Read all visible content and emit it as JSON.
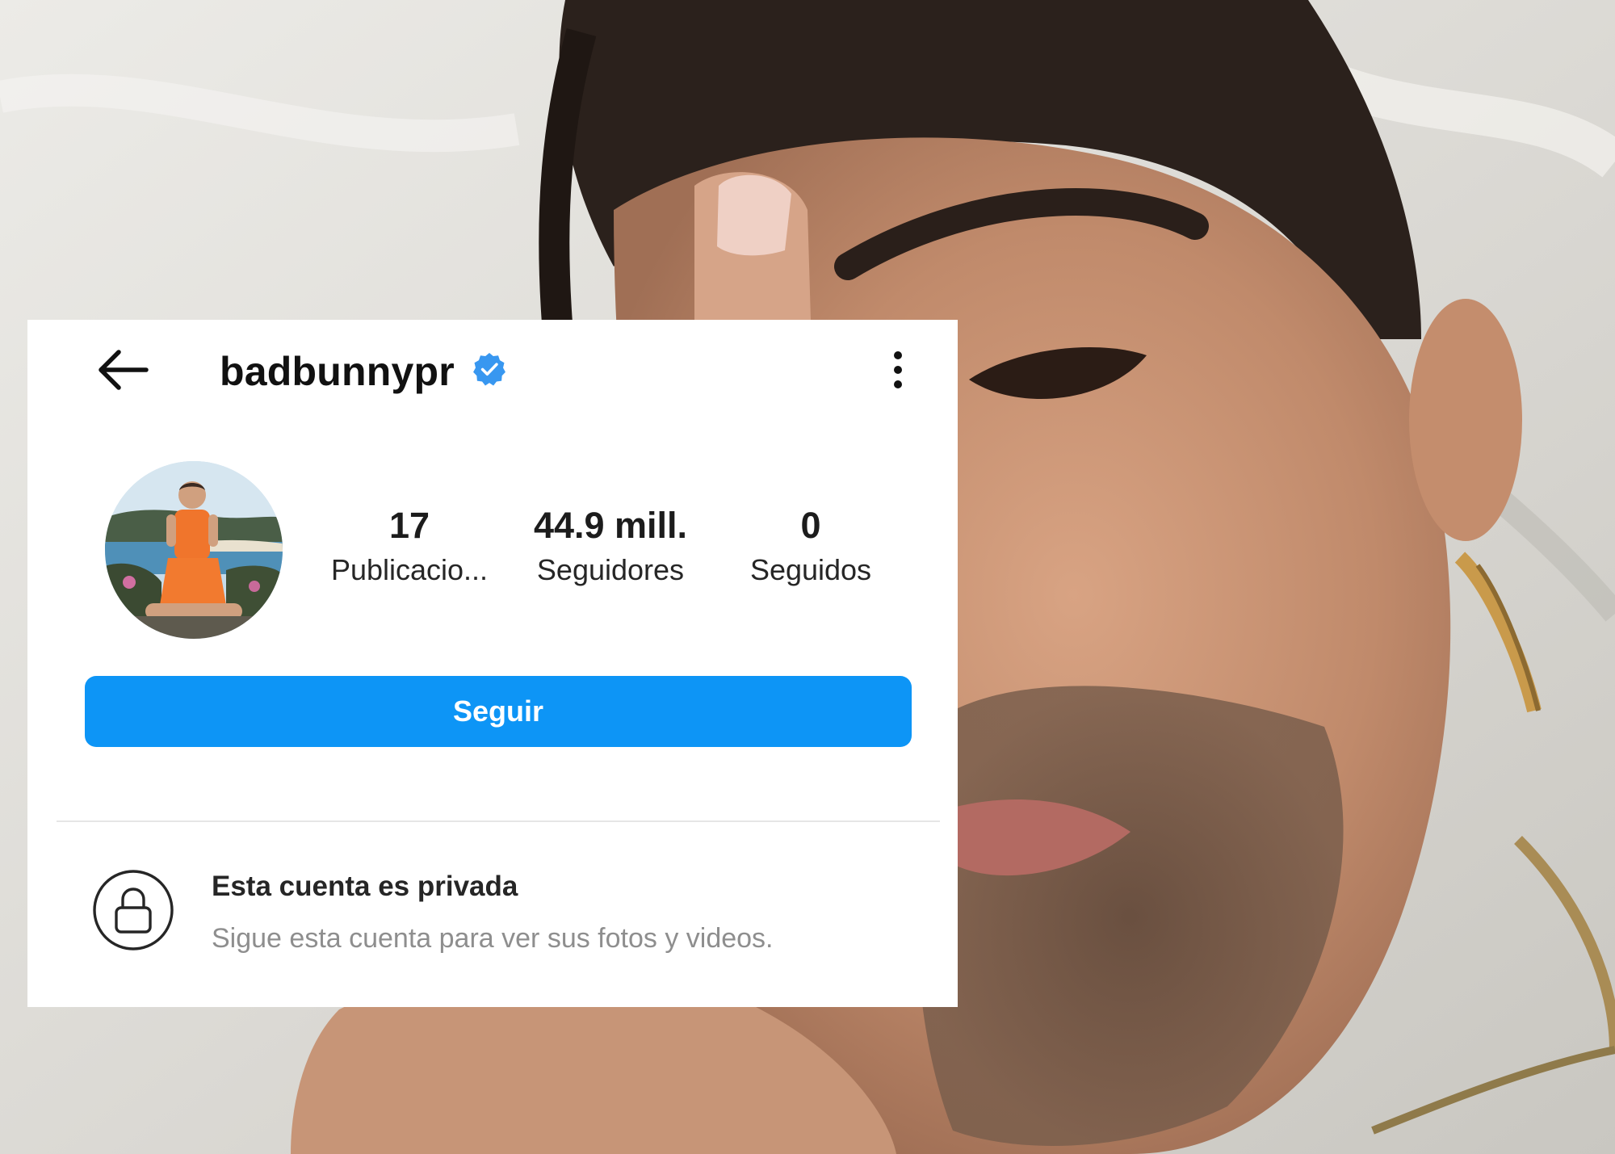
{
  "header": {
    "username": "badbunnypr"
  },
  "stats": {
    "posts": {
      "count": "17",
      "label": "Publicacio..."
    },
    "followers": {
      "count": "44.9 mill.",
      "label": "Seguidores"
    },
    "following": {
      "count": "0",
      "label": "Seguidos"
    }
  },
  "actions": {
    "follow_label": "Seguir"
  },
  "private_notice": {
    "title": "Esta cuenta es privada",
    "description": "Sigue esta cuenta para ver sus fotos y videos."
  },
  "colors": {
    "follow_button": "#0d95f6",
    "verified_badge": "#3897f0",
    "card_background": "#ffffff",
    "muted_text": "#8e8e8e"
  },
  "icons": {
    "back": "arrow-left-icon",
    "verified": "verified-badge-icon",
    "more": "more-vertical-icon",
    "lock": "lock-icon"
  }
}
